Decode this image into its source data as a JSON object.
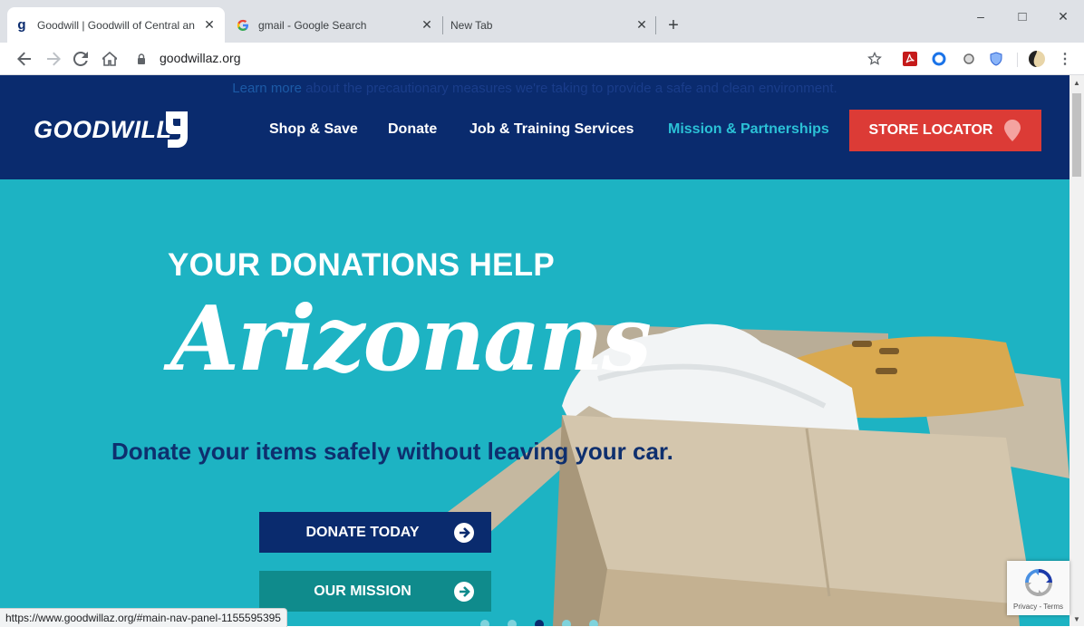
{
  "browser": {
    "tabs": [
      {
        "title": "Goodwill | Goodwill of Central an",
        "favicon": "goodwill-g",
        "active": true
      },
      {
        "title": "gmail - Google Search",
        "favicon": "google-g",
        "active": false
      },
      {
        "title": "New Tab",
        "favicon": "none",
        "active": false
      }
    ],
    "new_tab_symbol": "+",
    "window_controls": {
      "minimize": "–",
      "maximize": "□",
      "close": "✕"
    },
    "url": "goodwillaz.org",
    "status_url": "https://www.goodwillaz.org/#main-nav-panel-1155595395"
  },
  "site": {
    "notice": {
      "link": "Learn more",
      "text": " about the precautionary measures we're taking to provide a safe and clean environment."
    },
    "logo": "GOODWILL",
    "nav": [
      {
        "label": "Shop & Save",
        "active": false
      },
      {
        "label": "Donate",
        "active": false
      },
      {
        "label": "Job & Training Services",
        "active": false
      },
      {
        "label": "Mission & Partnerships",
        "active": true
      }
    ],
    "store_locator": "STORE LOCATOR",
    "hero": {
      "headline": "YOUR DONATIONS HELP",
      "script_word": "Arizonans",
      "subline": "Donate your items safely without leaving your car.",
      "cta_primary": "DONATE TODAY",
      "cta_secondary": "OUR MISSION",
      "slide_count": 5,
      "active_slide": 3
    },
    "recaptcha": "Privacy - Terms"
  },
  "colors": {
    "navy": "#0a2b6e",
    "teal_bg": "#1db3c3",
    "red": "#dc3b36",
    "nav_active": "#2bc1d6"
  }
}
